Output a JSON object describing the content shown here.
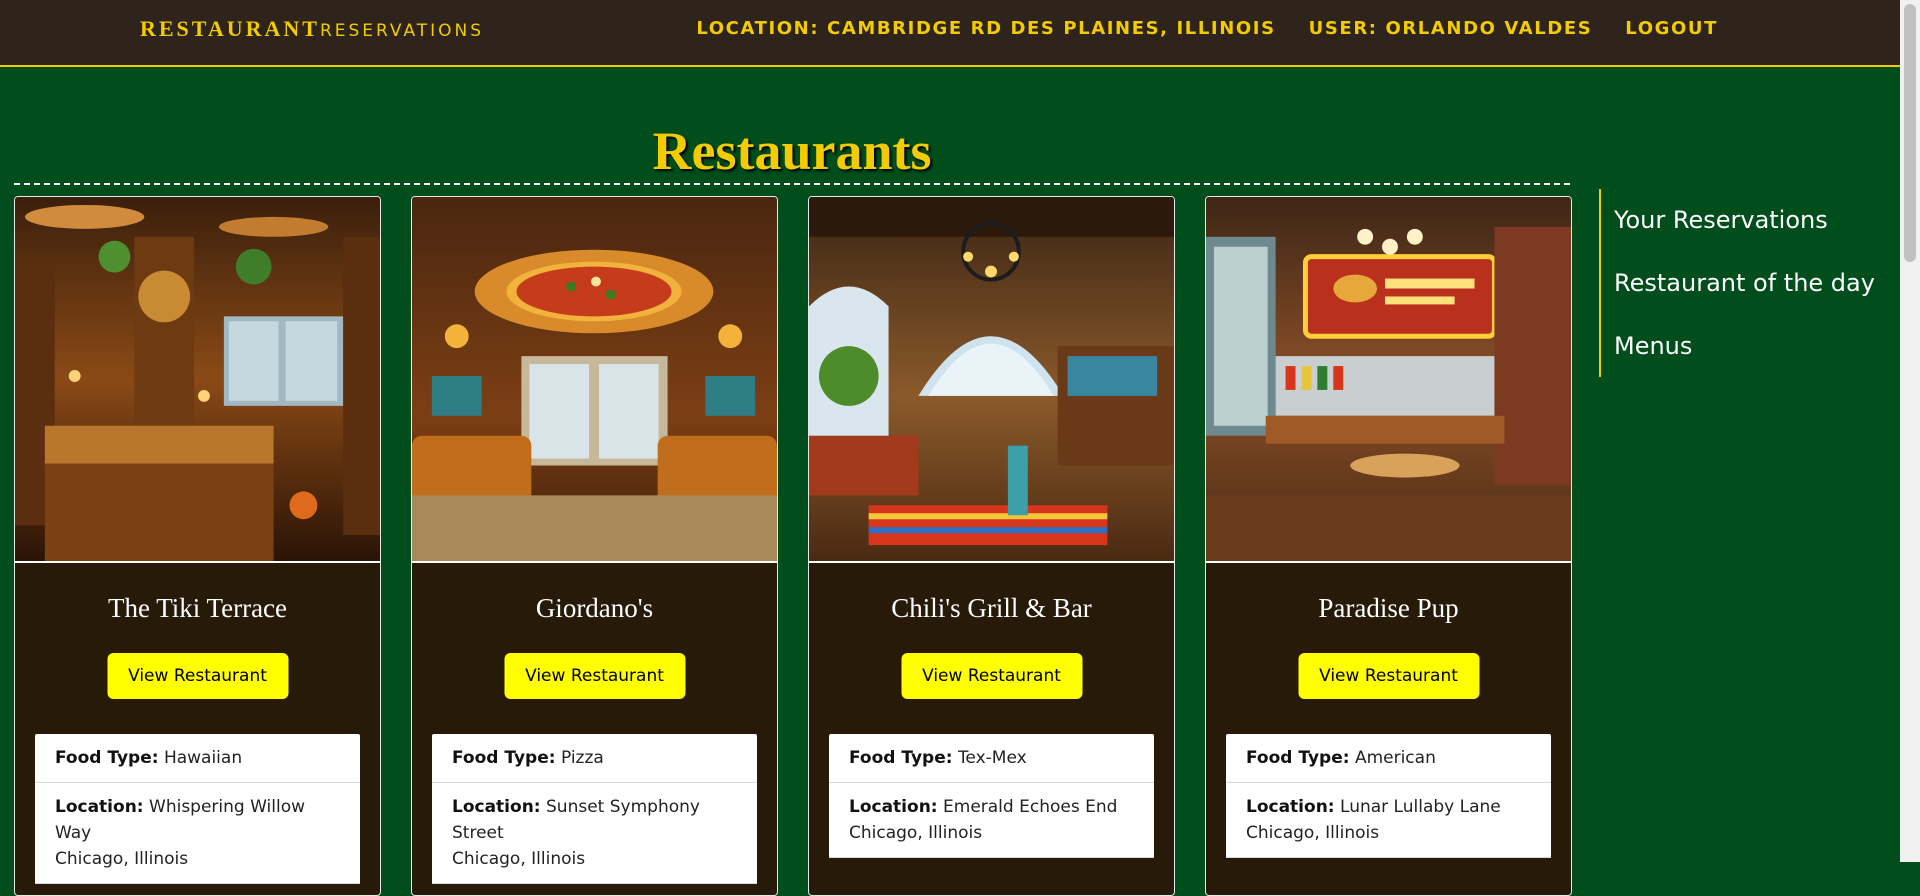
{
  "header": {
    "brand_primary": "RESTAURANT",
    "brand_secondary": "RESERVATIONS",
    "location": "LOCATION: CAMBRIDGE RD DES PLAINES, ILLINOIS",
    "user": "USER: ORLANDO VALDES",
    "logout": "LOGOUT"
  },
  "page": {
    "title": "Restaurants"
  },
  "sidebar": {
    "items": [
      {
        "label": "Your Reservations"
      },
      {
        "label": "Restaurant of the day"
      },
      {
        "label": "Menus"
      }
    ]
  },
  "labels": {
    "food_type": "Food Type:",
    "location": "Location:",
    "button": "View Restaurant"
  },
  "restaurants": [
    {
      "name": "The Tiki Terrace",
      "food_type": "Hawaiian",
      "street": "Whispering Willow Way",
      "city": "Chicago, Illinois",
      "scene": "tiki"
    },
    {
      "name": "Giordano's",
      "food_type": "Pizza",
      "street": "Sunset Symphony Street",
      "city": "Chicago, Illinois",
      "scene": "pizza"
    },
    {
      "name": "Chili's Grill & Bar",
      "food_type": "Tex-Mex",
      "street": "Emerald Echoes End",
      "city": "Chicago, Illinois",
      "scene": "texmex"
    },
    {
      "name": "Paradise Pup",
      "food_type": "American",
      "street": "Lunar Lullaby Lane",
      "city": "Chicago, Illinois",
      "scene": "diner"
    }
  ],
  "colors": {
    "accent": "#f2cc00",
    "background": "#014d1b",
    "header": "#2e241b",
    "card": "#281a09",
    "button": "#ffff00"
  }
}
